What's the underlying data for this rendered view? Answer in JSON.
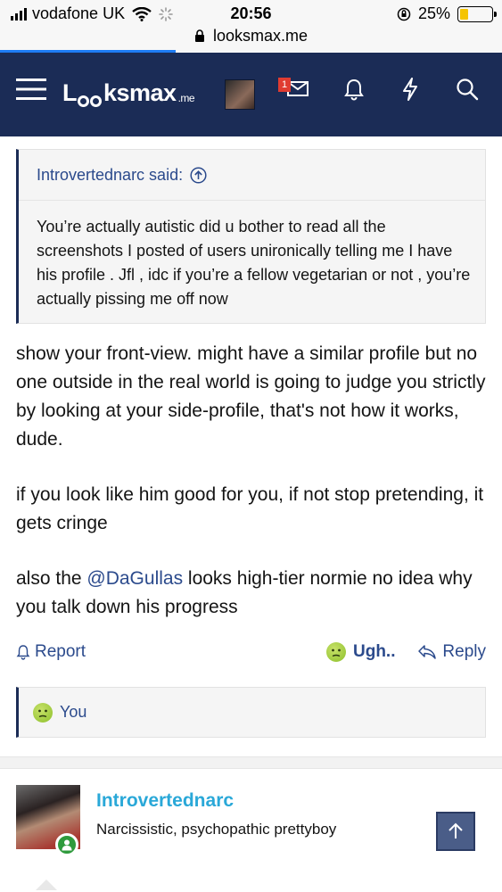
{
  "status_bar": {
    "carrier": "vodafone UK",
    "time": "20:56",
    "battery": "25%",
    "battery_level": 0.25,
    "url": "looksmax.me",
    "load_progress": 0.35
  },
  "navbar": {
    "logo_main_pre": "L",
    "logo_main_post": "ksmax",
    "logo_suffix": ".me",
    "notification_count": "1",
    "icons": [
      "menu-icon",
      "avatar",
      "inbox-icon",
      "bell-icon",
      "bolt-icon",
      "search-icon"
    ]
  },
  "quote": {
    "author_said": "Introvertednarc said:",
    "text": "You’re actually autistic did u bother to read all the screenshots I posted of users unironically telling me I have his profile . Jfl , idc if you’re a fellow vegetarian or not , you’re actually pissing me off now"
  },
  "post": {
    "para1": "show your front-view. might have a similar profile but no one outside in the real world is going to judge you strictly by looking at your side-profile, that's not how it works, dude.",
    "para2": "if you look like him good for you, if not stop pretending, it gets cringe",
    "para3_pre": "also the ",
    "para3_mention": "@DaGullas",
    "para3_post": " looks high-tier normie no idea why you talk down his progress"
  },
  "actions": {
    "report": "Report",
    "reaction": "Ugh..",
    "reply": "Reply"
  },
  "reactions_bar": {
    "who": "You"
  },
  "next_post": {
    "username": "Introvertednarc",
    "user_title": "Narcissistic, psychopathic prettyboy"
  },
  "colors": {
    "navbar": "#1b2c56",
    "link": "#2b4a8c",
    "username": "#2aa8d8",
    "online": "#2e9a3c"
  }
}
